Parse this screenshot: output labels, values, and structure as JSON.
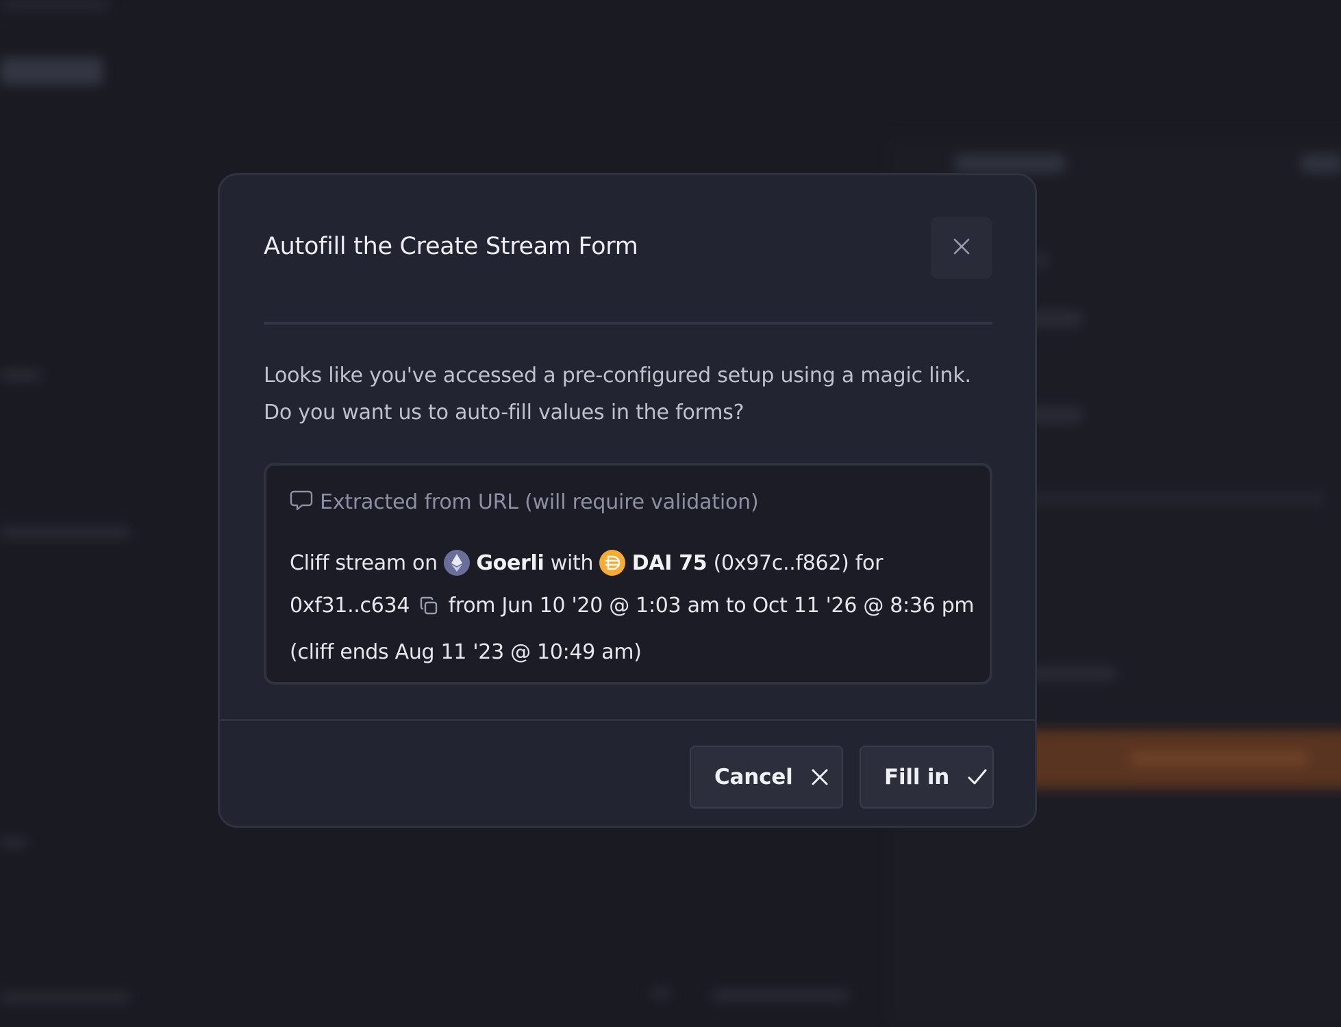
{
  "modal": {
    "title": "Autofill the Create Stream Form",
    "close_icon": "close-icon",
    "description": "Looks like you've accessed a pre-configured setup using a magic link. Do you want us to auto-fill values in the forms?",
    "extracted": {
      "header_icon": "speech-bubble-icon",
      "header": "Extracted from URL (will require validation)",
      "stream_type_prefix": "Cliff stream on",
      "chain_icon": "ethereum-icon",
      "chain": "Goerli",
      "with_word": "with",
      "token_icon": "dai-icon",
      "token_amount": "DAI 75",
      "token_address": "(0x97c..f862)",
      "for_word": "for",
      "recipient": "0xf31..c634",
      "copy_icon": "copy-icon",
      "range": "from Jun 10 '20 @ 1:03 am to Oct 11 '26 @ 8:36 pm",
      "cliff": "(cliff ends Aug 11 '23 @ 10:49 am)"
    },
    "footer": {
      "cancel_label": "Cancel",
      "cancel_icon": "x-icon",
      "fill_label": "Fill in",
      "fill_icon": "checkmark-icon"
    }
  },
  "colors": {
    "background": "#191a22",
    "modal": "#222431",
    "extract_box": "#1b1c25",
    "button": "#2c2e3c",
    "ethereum": "#6b6e99",
    "dai": "#f5ac37",
    "backdrop_accent": "#8f4a1f"
  }
}
